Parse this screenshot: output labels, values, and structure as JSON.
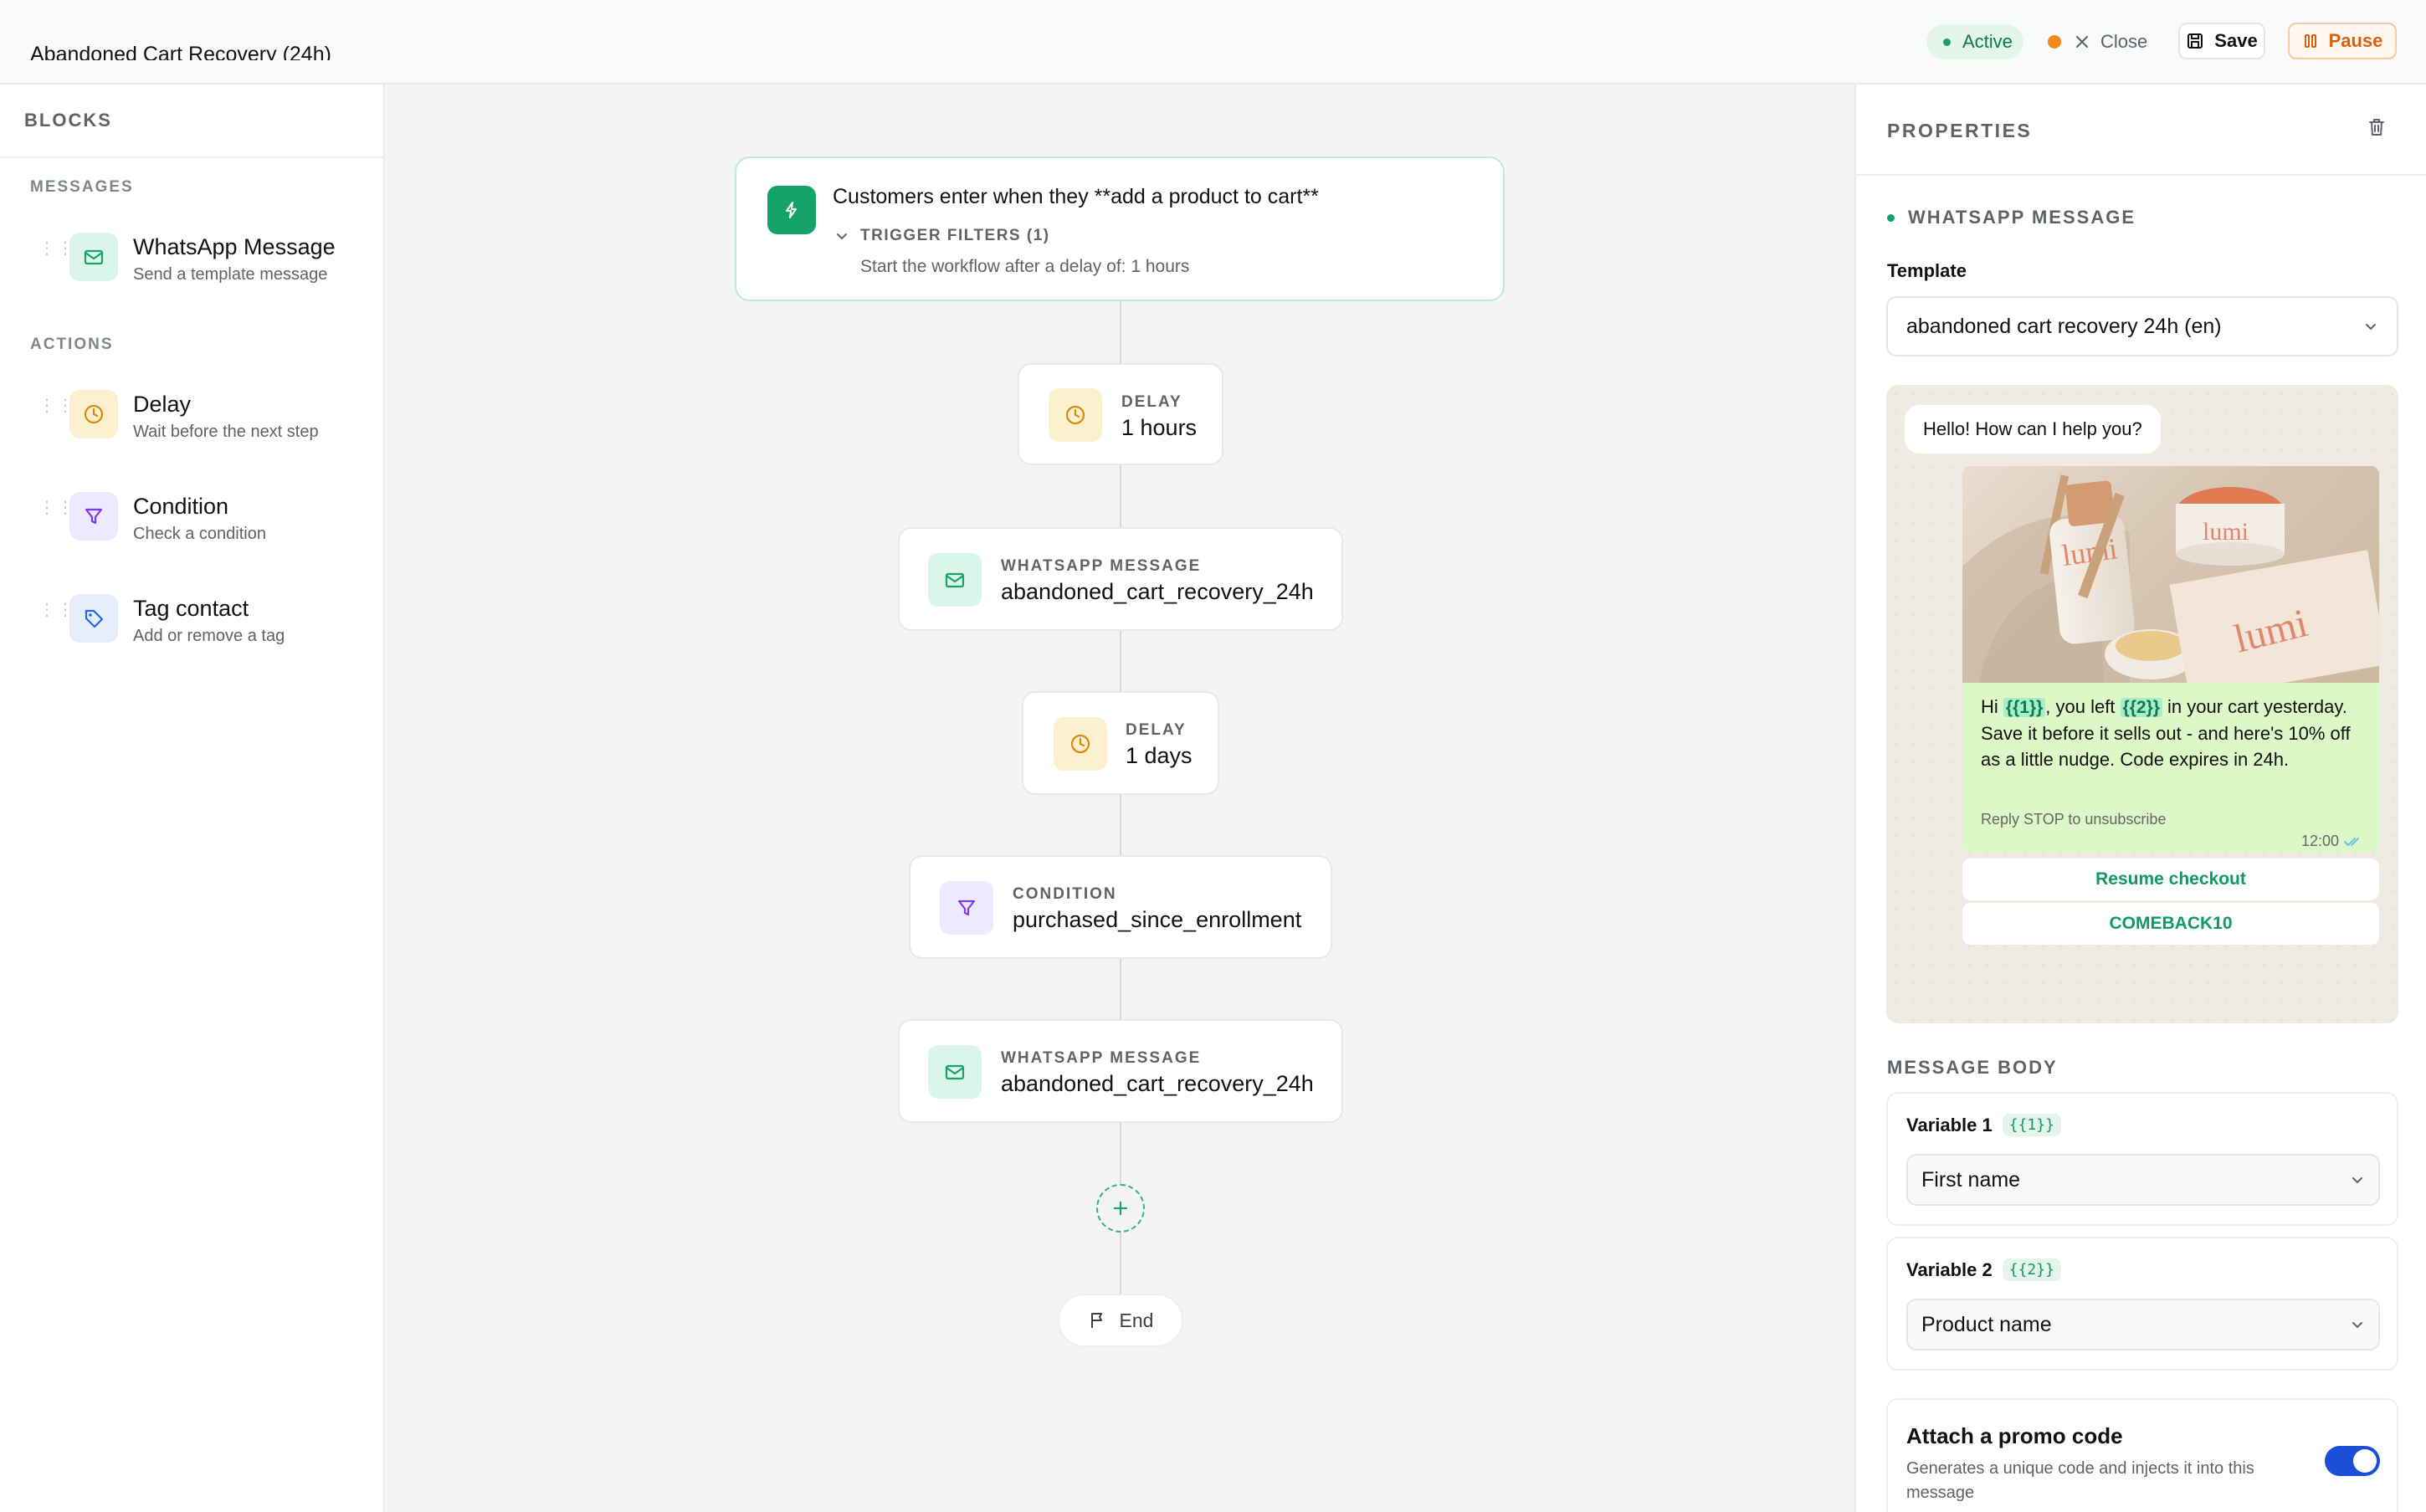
{
  "header": {
    "workflow_title": "Abandoned Cart Recovery (24h)",
    "status": "Active",
    "close_label": "Close",
    "save_label": "Save",
    "pause_label": "Pause"
  },
  "sidebar": {
    "title": "BLOCKS",
    "sections": {
      "messages": "MESSAGES",
      "actions": "ACTIONS"
    },
    "items": [
      {
        "name": "WhatsApp Message",
        "desc": "Send a template message",
        "icon": "message-icon"
      },
      {
        "name": "Delay",
        "desc": "Wait before the next step",
        "icon": "clock-icon"
      },
      {
        "name": "Condition",
        "desc": "Check a condition",
        "icon": "filter-icon"
      },
      {
        "name": "Tag contact",
        "desc": "Add or remove a tag",
        "icon": "tag-icon"
      }
    ]
  },
  "canvas": {
    "trigger": {
      "text": "Customers enter when they **add a product to cart**",
      "filters_label": "TRIGGER FILTERS (1)",
      "filter_detail": "Start the workflow after a delay of: 1 hours"
    },
    "nodes": [
      {
        "type": "DELAY",
        "value": "1 hours"
      },
      {
        "type": "WHATSAPP MESSAGE",
        "value": "abandoned_cart_recovery_24h"
      },
      {
        "type": "DELAY",
        "value": "1 days"
      },
      {
        "type": "CONDITION",
        "value": "purchased_since_enrollment"
      },
      {
        "type": "WHATSAPP MESSAGE",
        "value": "abandoned_cart_recovery_24h"
      }
    ],
    "end_label": "End"
  },
  "properties": {
    "title": "PROPERTIES",
    "block_type": "WHATSAPP MESSAGE",
    "template_label": "Template",
    "template_value": "abandoned cart recovery 24h (en)",
    "preview": {
      "incoming": "Hello! How can I help you?",
      "brand_text": "lumi",
      "body_parts": {
        "p1": "Hi ",
        "v1": "{{1}}",
        "p2": ", you left ",
        "v2": "{{2}}",
        "p3": " in your cart yesterday. Save it before it sells out - and here's 10% off as a little nudge. Code expires in 24h."
      },
      "footer": "Reply STOP to unsubscribe",
      "time": "12:00",
      "buttons": [
        "Resume checkout",
        "COMEBACK10"
      ]
    },
    "message_body_label": "MESSAGE BODY",
    "variables": [
      {
        "label": "Variable 1",
        "chip": "{{1}}",
        "value": "First name"
      },
      {
        "label": "Variable 2",
        "chip": "{{2}}",
        "value": "Product name"
      }
    ],
    "promo": {
      "title": "Attach a promo code",
      "desc": "Generates a unique code and injects it into this message",
      "enabled": true
    }
  },
  "colors": {
    "accent_green": "#16a364",
    "pause_orange": "#d9600a",
    "toggle_blue": "#1d4ed8"
  }
}
